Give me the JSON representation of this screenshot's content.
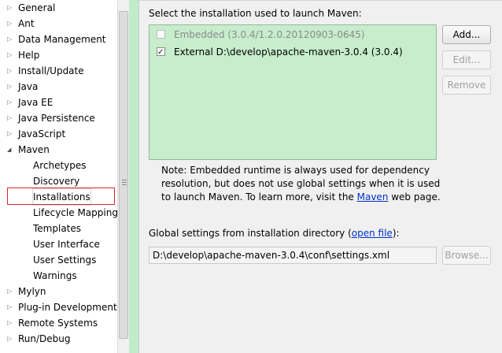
{
  "tree": {
    "items": [
      {
        "label": "General",
        "expandable": true
      },
      {
        "label": "Ant",
        "expandable": true
      },
      {
        "label": "Data Management",
        "expandable": true
      },
      {
        "label": "Help",
        "expandable": true
      },
      {
        "label": "Install/Update",
        "expandable": true
      },
      {
        "label": "Java",
        "expandable": true
      },
      {
        "label": "Java EE",
        "expandable": true
      },
      {
        "label": "Java Persistence",
        "expandable": true
      },
      {
        "label": "JavaScript",
        "expandable": true
      },
      {
        "label": "Maven",
        "expanded": true
      },
      {
        "label": "Archetypes",
        "child": true
      },
      {
        "label": "Discovery",
        "child": true
      },
      {
        "label": "Installations",
        "child": true,
        "selected": true
      },
      {
        "label": "Lifecycle Mapping",
        "child": true
      },
      {
        "label": "Templates",
        "child": true
      },
      {
        "label": "User Interface",
        "child": true
      },
      {
        "label": "User Settings",
        "child": true
      },
      {
        "label": "Warnings",
        "child": true
      },
      {
        "label": "Mylyn",
        "expandable": true
      },
      {
        "label": "Plug-in Development",
        "expandable": true
      },
      {
        "label": "Remote Systems",
        "expandable": true
      },
      {
        "label": "Run/Debug",
        "expandable": true
      }
    ]
  },
  "main": {
    "installations_label": "Select the installation used to launch Maven:",
    "installations": [
      {
        "label": "Embedded (3.0.4/1.2.0.20120903-0645)",
        "checked": false,
        "disabled": true
      },
      {
        "label": "External D:\\develop\\apache-maven-3.0.4 (3.0.4)",
        "checked": true,
        "disabled": false
      }
    ],
    "buttons": {
      "add": "Add...",
      "edit": "Edit...",
      "remove": "Remove",
      "browse": "Browse..."
    },
    "note": {
      "line1": "Note: Embedded runtime is always used for dependency",
      "line2": "resolution, but does not use global settings when it is used",
      "line3_prefix": "to launch Maven. To learn more, visit the ",
      "line3_link": "Maven",
      "line3_suffix": " web page."
    },
    "global_settings": {
      "label_prefix": "Global settings from installation directory (",
      "label_link": "open file",
      "label_suffix": "):",
      "path": "D:\\develop\\apache-maven-3.0.4\\conf\\settings.xml"
    }
  },
  "colors": {
    "list_background": "#c7edcc",
    "highlight_border": "#d9262c",
    "link": "#0033cc"
  }
}
